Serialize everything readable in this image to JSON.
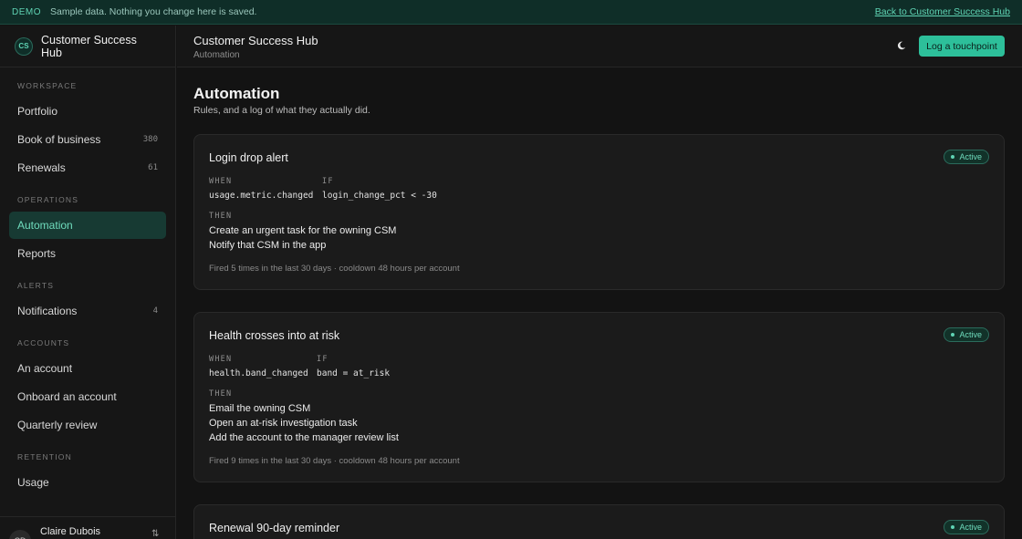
{
  "banner": {
    "tag": "DEMO",
    "message": "Sample data. Nothing you change here is saved.",
    "back_link": "Back to Customer Success Hub"
  },
  "sidebar": {
    "logo": "CS",
    "app_name": "Customer Success Hub",
    "sections": [
      {
        "heading": "WORKSPACE",
        "items": [
          {
            "label": "Portfolio",
            "count": ""
          },
          {
            "label": "Book of business",
            "count": "380"
          },
          {
            "label": "Renewals",
            "count": "61"
          }
        ]
      },
      {
        "heading": "OPERATIONS",
        "items": [
          {
            "label": "Automation",
            "count": ""
          },
          {
            "label": "Reports",
            "count": ""
          }
        ]
      },
      {
        "heading": "ALERTS",
        "items": [
          {
            "label": "Notifications",
            "count": "4"
          }
        ]
      },
      {
        "heading": "ACCOUNTS",
        "items": [
          {
            "label": "An account",
            "count": ""
          },
          {
            "label": "Onboard an account",
            "count": ""
          },
          {
            "label": "Quarterly review",
            "count": ""
          }
        ]
      },
      {
        "heading": "RETENTION",
        "items": [
          {
            "label": "Usage",
            "count": ""
          }
        ]
      }
    ],
    "active_item": "Automation",
    "user": {
      "initials": "CD",
      "name": "Claire Dubois"
    }
  },
  "topbar": {
    "title": "Customer Success Hub",
    "subtitle": "Automation",
    "theme_icon": "moon-icon",
    "cta_label": "Log a touchpoint"
  },
  "main": {
    "title": "Automation",
    "subtitle": "Rules, and a log of what they actually did.",
    "rules": [
      {
        "name": "Login drop alert",
        "status": "Active",
        "when_label": "WHEN",
        "when": "usage.metric.changed",
        "if_label": "IF",
        "if": "login_change_pct < -30",
        "then_label": "THEN",
        "actions": [
          "Create an urgent task for the owning CSM",
          "Notify that CSM in the app"
        ],
        "footer": "Fired 5 times in the last 30 days · cooldown 48 hours per account"
      },
      {
        "name": "Health crosses into at risk",
        "status": "Active",
        "when_label": "WHEN",
        "when": "health.band_changed",
        "if_label": "IF",
        "if": "band = at_risk",
        "then_label": "THEN",
        "actions": [
          "Email the owning CSM",
          "Open an at-risk investigation task",
          "Add the account to the manager review list"
        ],
        "footer": "Fired 9 times in the last 30 days · cooldown 48 hours per account"
      },
      {
        "name": "Renewal 90-day reminder",
        "status": "Active"
      }
    ]
  },
  "colors": {
    "accent": "#2dbf9a",
    "accent_text": "#6fdcbd",
    "background": "#131313",
    "card": "#1b1b1b"
  }
}
